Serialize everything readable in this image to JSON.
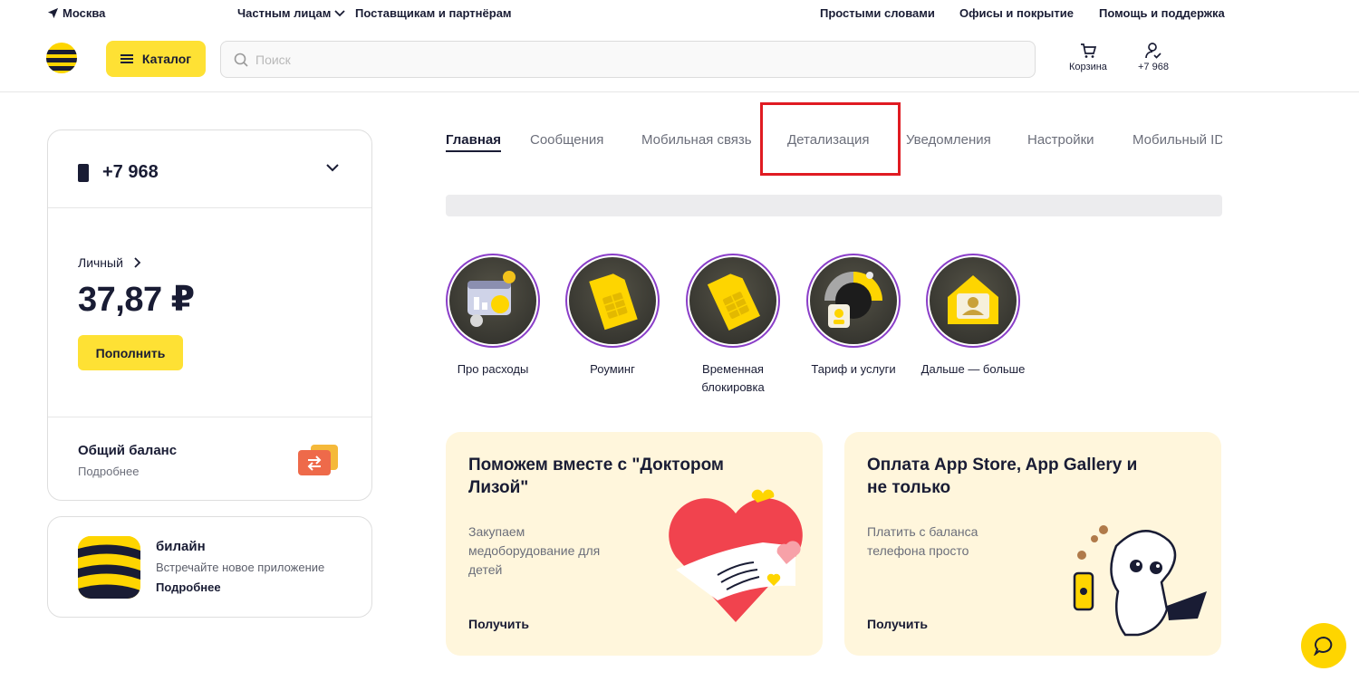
{
  "topbar": {
    "city": "Москва",
    "segment": "Частным лицам",
    "partners": "Поставщикам и партнёрам",
    "simple_words": "Простыми словами",
    "offices": "Офисы и покрытие",
    "help": "Помощь и поддержка"
  },
  "header": {
    "catalog_label": "Каталог",
    "search_placeholder": "Поиск",
    "cart_label": "Корзина",
    "profile_label": "+7 968"
  },
  "account": {
    "phone": "+7 968",
    "balance_label": "Личный",
    "balance_value": "37,87 ₽",
    "topup_label": "Пополнить",
    "shared_title": "Общий баланс",
    "shared_more": "Подробнее"
  },
  "app_promo": {
    "title": "билайн",
    "subtitle": "Встречайте новое приложение",
    "more": "Подробнее"
  },
  "tabs": [
    {
      "label": "Главная"
    },
    {
      "label": "Сообщения"
    },
    {
      "label": "Мобильная связь"
    },
    {
      "label": "Детализация"
    },
    {
      "label": "Уведомления"
    },
    {
      "label": "Настройки"
    },
    {
      "label": "Мобильный ID"
    }
  ],
  "stories": [
    {
      "label": "Про расходы"
    },
    {
      "label": "Роуминг"
    },
    {
      "label": "Временная блокировка"
    },
    {
      "label": "Тариф и услуги"
    },
    {
      "label": "Дальше — больше"
    }
  ],
  "promos": [
    {
      "title": "Поможем вместе с \"Доктором Лизой\"",
      "text": "Закупаем медоборудование для детей",
      "cta": "Получить"
    },
    {
      "title": "Оплата App Store, App Gallery и не только",
      "text": "Платить с баланса телефона просто",
      "cta": "Получить"
    }
  ],
  "colors": {
    "brand_yellow": "#fed500",
    "text_dark": "#191c34",
    "muted": "#6b6e7a",
    "highlight_red": "#e01b22",
    "story_ring": "#8a3ec8",
    "promo_bg": "#fff6dc"
  }
}
